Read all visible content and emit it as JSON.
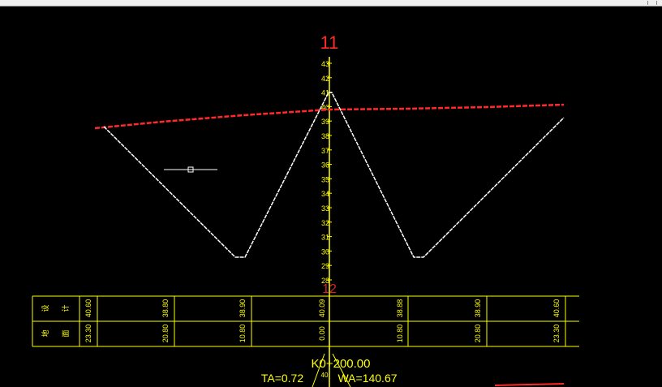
{
  "window": {
    "has_top_strip": true
  },
  "drawing": {
    "section_label": "11",
    "next_label": "12",
    "station_label": "K0+200.00",
    "ta_label": "TA=0.72",
    "wa_label": "WA=140.67",
    "center_small_label": "40",
    "axis_ticks": [
      "43",
      "42",
      "41",
      "40",
      "39",
      "38",
      "37",
      "36",
      "35",
      "34",
      "33",
      "32",
      "31",
      "30",
      "29",
      "28"
    ],
    "table": {
      "row_labels_left": [
        "设计",
        "地面"
      ],
      "row1_values": [
        "40.60",
        "38.80",
        "38.90",
        "40.09",
        "38.88",
        "38.90",
        "40.60"
      ],
      "row2_values": [
        "23.30",
        "20.80",
        "10.80",
        "0.00",
        "10.80",
        "20.80",
        "23.30"
      ]
    },
    "colors": {
      "background": "#000000",
      "ground_line": "#ff2a2a",
      "design_line": "#ffffff",
      "annotation": "#ffff00",
      "label_red": "#ff2a2a"
    }
  }
}
